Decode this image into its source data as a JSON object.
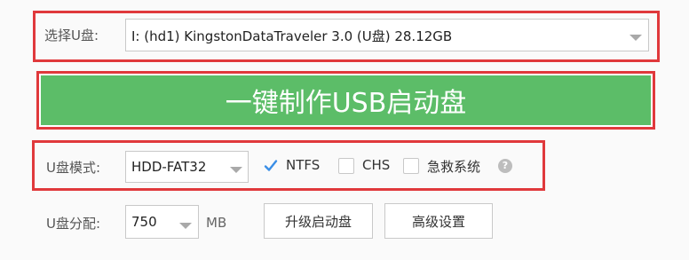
{
  "disk": {
    "label": "选择U盘:",
    "selected": "I: (hd1) KingstonDataTraveler 3.0 (U盘) 28.12GB"
  },
  "main_button": {
    "label": "一键制作USB启动盘",
    "color": "#5cbd68"
  },
  "mode": {
    "label": "U盘模式:",
    "selected": "HDD-FAT32",
    "options": [
      {
        "label": "NTFS",
        "checked": true
      },
      {
        "label": "CHS",
        "checked": false
      },
      {
        "label": "急救系统",
        "checked": false
      }
    ],
    "help_icon": "question-circle-icon"
  },
  "allocation": {
    "label": "U盘分配:",
    "selected": "750",
    "unit": "MB"
  },
  "buttons": {
    "upgrade": "升级启动盘",
    "advanced": "高级设置"
  },
  "colors": {
    "highlight_border": "#e0393c",
    "check_accent": "#3a8ee6"
  }
}
